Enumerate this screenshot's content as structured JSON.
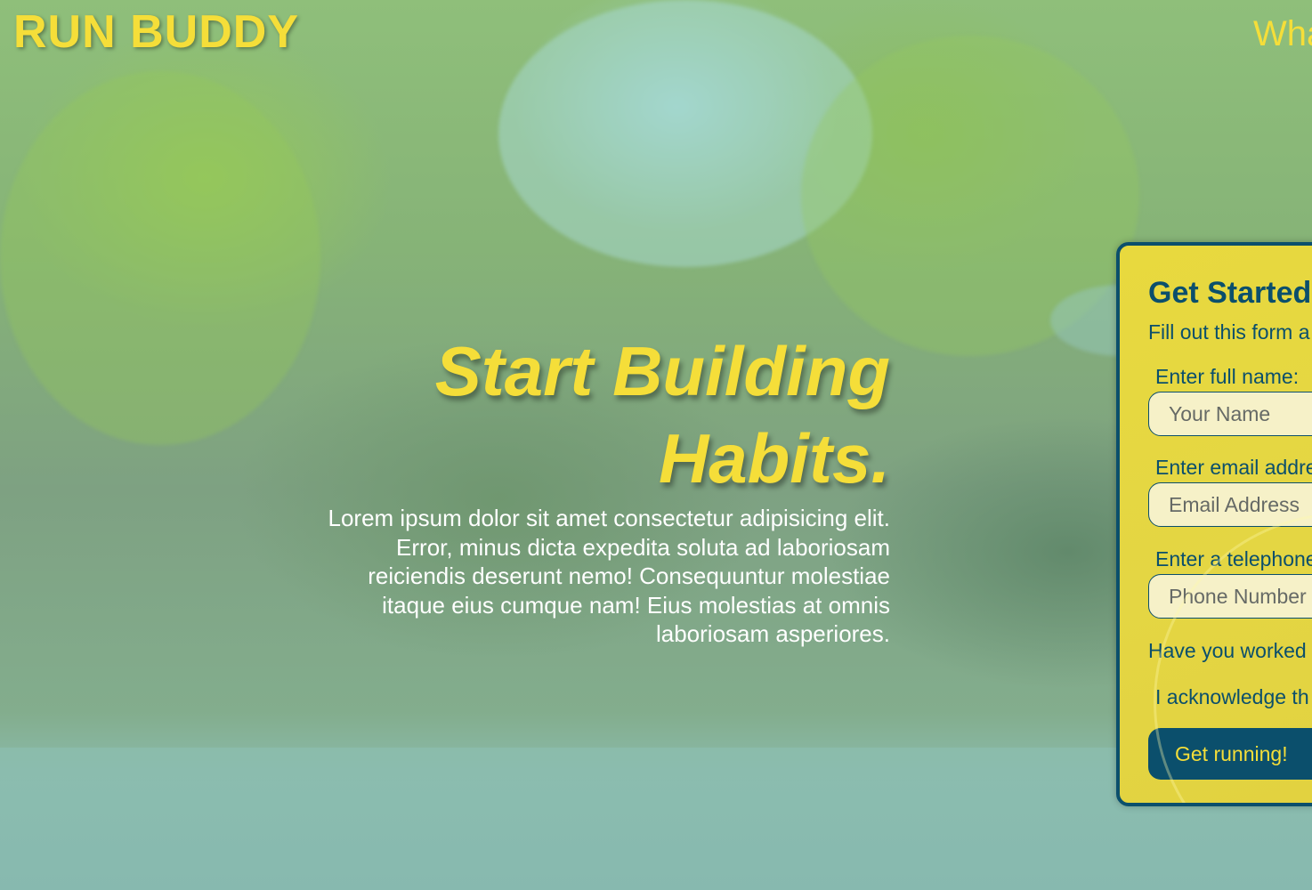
{
  "header": {
    "site_title": "RUN BUDDY",
    "nav_link_partial": "Wha"
  },
  "hero": {
    "title_line1": "Start Building",
    "title_line2": "Habits.",
    "body": "Lorem ipsum dolor sit amet consectetur adipisicing elit. Error, minus dicta expedita soluta ad laboriosam reiciendis deserunt nemo! Consequuntur molestiae itaque eius cumque nam! Eius molestias at omnis laboriosam asperiores."
  },
  "signup_form": {
    "title": "Get Started",
    "subtitle": "Fill out this form a",
    "name_label": "Enter full name:",
    "name_placeholder": "Your Name",
    "email_label": "Enter email addre",
    "email_placeholder": "Email Address",
    "phone_label": "Enter a telephone",
    "phone_placeholder": "Phone Number",
    "worked_question": "Have you worked",
    "acknowledge_text": "I acknowledge th",
    "submit_label": "Get running!"
  },
  "colors": {
    "brand_yellow": "#f5de39",
    "brand_navy": "#0b4f6c",
    "form_background": "#e4d643",
    "input_background": "#f6f1c8"
  }
}
